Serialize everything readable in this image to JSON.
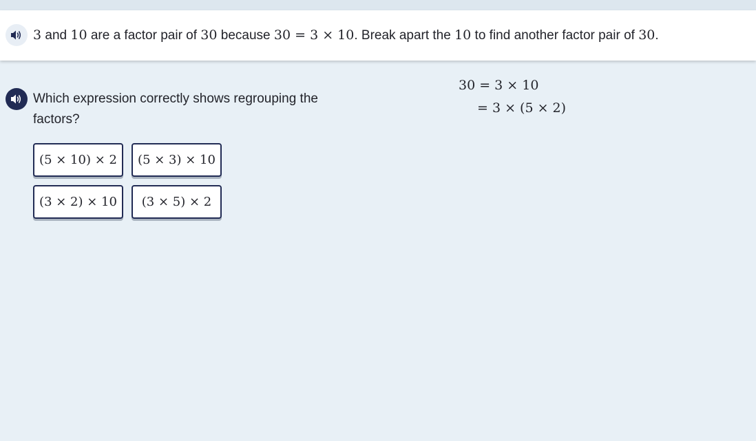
{
  "header": {
    "parts": [
      {
        "type": "math",
        "text": "3"
      },
      {
        "type": "text",
        "text": " and "
      },
      {
        "type": "math",
        "text": "10"
      },
      {
        "type": "text",
        "text": " are a factor pair of "
      },
      {
        "type": "math",
        "text": "30"
      },
      {
        "type": "text",
        "text": " because "
      },
      {
        "type": "math",
        "text": "30 = 3 × 10"
      },
      {
        "type": "text",
        "text": ". Break apart the "
      },
      {
        "type": "math",
        "text": "10"
      },
      {
        "type": "text",
        "text": " to find another factor pair of "
      },
      {
        "type": "math",
        "text": "30"
      },
      {
        "type": "text",
        "text": "."
      }
    ]
  },
  "question": {
    "text": "Which expression correctly shows regrouping the factors?"
  },
  "choices": [
    {
      "label": "(5 × 10) × 2"
    },
    {
      "label": "(5 × 3) × 10"
    },
    {
      "label": "(3 × 2) × 10"
    },
    {
      "label": "(3 × 5) × 2"
    }
  ],
  "work": {
    "line1": "30 = 3 × 10",
    "line2": "= 3 × (5 × 2)"
  },
  "icons": {
    "header_audio": "speaker-icon",
    "question_audio": "speaker-icon"
  },
  "colors": {
    "background": "#e8f0f6",
    "header_bg": "#ffffff",
    "navy": "#212b54"
  }
}
